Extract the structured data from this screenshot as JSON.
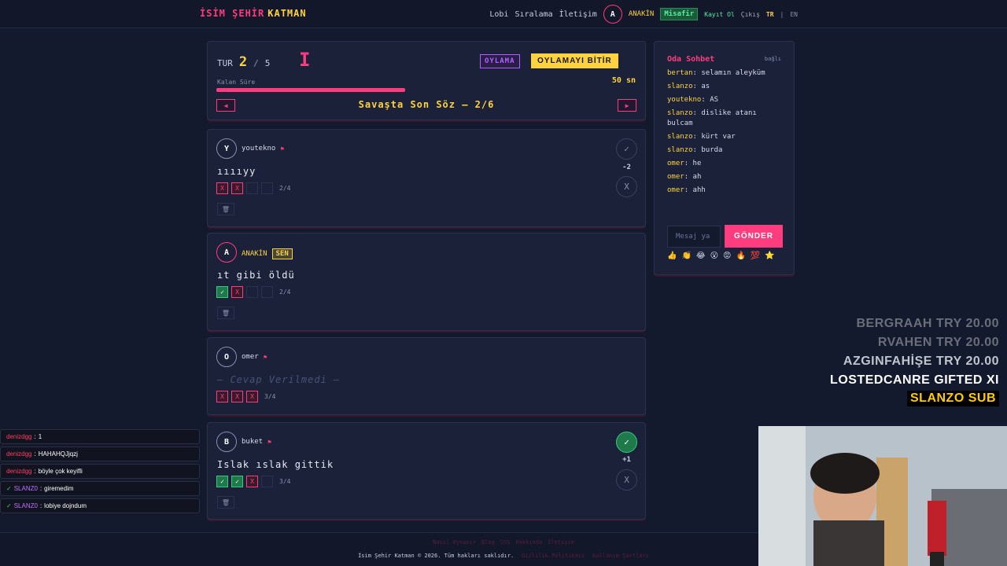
{
  "app": {
    "logo_a": "İSİM ŞEHİR",
    "logo_b": "KATMAN"
  },
  "nav": {
    "lobby": "Lobi",
    "ranking": "Sıralama",
    "contact": "İletişim",
    "avatar": "A",
    "username": "ANAKİN",
    "guest": "Misafir",
    "register": "Kayıt Ol",
    "logout": "Çıkış",
    "lang_tr": "TR",
    "lang_sep": "|",
    "lang_en": "EN"
  },
  "round": {
    "label": "TUR",
    "current": "2",
    "sep": "/",
    "total": "5",
    "letter": "I",
    "mode": "OYLAMA",
    "finish_vote": "OYLAMAYI BİTİR",
    "time_label": "Kalan Süre",
    "time_value": "50 sn",
    "progress": 0.45,
    "prev": "◀",
    "next": "▶",
    "category": "Savaşta Son Söz — 2/6"
  },
  "players": [
    {
      "avatar": "Y",
      "name": "youtekno",
      "flag": "⚑",
      "me": false,
      "answer": "ııııyy",
      "votes": [
        "x",
        "x",
        "",
        ""
      ],
      "vote_count": "2/4",
      "score": "-2",
      "approved": false
    },
    {
      "avatar": "A",
      "name": "ANAKİN",
      "me_badge": "SEN",
      "me": true,
      "answer": "ıt gibi öldü",
      "votes": [
        "ok",
        "x",
        "",
        ""
      ],
      "vote_count": "2/4"
    },
    {
      "avatar": "O",
      "name": "omer",
      "flag": "⚑",
      "me": false,
      "answer": "— Cevap Verilmedi —",
      "votes": [
        "x",
        "x",
        "x"
      ],
      "vote_count": "3/4"
    },
    {
      "avatar": "B",
      "name": "buket",
      "flag": "⚑",
      "me": false,
      "answer": "Islak ıslak gittik",
      "votes": [
        "ok",
        "ok",
        "x",
        ""
      ],
      "vote_count": "3/4",
      "score": "+1",
      "approved": true
    }
  ],
  "chat": {
    "title": "Oda Sohbet",
    "status": "bağlı",
    "messages": [
      {
        "user": "bertan",
        "text": "selamın aleyküm"
      },
      {
        "user": "slanzo",
        "text": "as"
      },
      {
        "user": "youtekno",
        "text": "AS"
      },
      {
        "user": "slanzo",
        "text": "dislike atanı bulcam"
      },
      {
        "user": "slanzo",
        "text": "kürt var"
      },
      {
        "user": "slanzo",
        "text": "burda"
      },
      {
        "user": "omer",
        "text": "he"
      },
      {
        "user": "omer",
        "text": "ah"
      },
      {
        "user": "omer",
        "text": "ahh"
      }
    ],
    "placeholder": "Mesaj ya",
    "send": "GÖNDER",
    "emojis": [
      "👍",
      "👏",
      "😂",
      "😮",
      "😡",
      "🔥",
      "💯",
      "⭐"
    ]
  },
  "footer": {
    "links": [
      "Nasıl Oynanır",
      "Blog",
      "SSS",
      "Hakkında",
      "İletişim"
    ],
    "copyright": "İsim Şehir Katman © 2026. Tüm hakları saklıdır.",
    "privacy": "Gizlilik Politikası",
    "terms": "Kullanım Şartları"
  },
  "stream_overlay": [
    {
      "text": "BERGRAAH  TRY 20.00",
      "color": "#6a6e78"
    },
    {
      "text": "RVAHEN  TRY 20.00",
      "color": "#6a6e78"
    },
    {
      "text": "AZGINFAHİŞE  TRY 20.00",
      "color": "#c0c4cc"
    },
    {
      "text": "LOSTEDCANRE  GIFTED XI",
      "color": "#ffffff"
    },
    {
      "text": "SLANZO  SUB",
      "color": "#ffcc00"
    }
  ],
  "twitch_chat": [
    {
      "user": "denizdgg",
      "text": "1",
      "badge": ""
    },
    {
      "user": "denizdgg",
      "text": "HAHAHQJjqzj",
      "badge": ""
    },
    {
      "user": "denizdgg",
      "text": "böyle çok keyifli",
      "badge": ""
    },
    {
      "user": "SLANZ0",
      "text": "giremedim",
      "badge": "✓"
    },
    {
      "user": "SLANZ0",
      "text": "lobiye dojndum",
      "badge": "✓"
    }
  ]
}
